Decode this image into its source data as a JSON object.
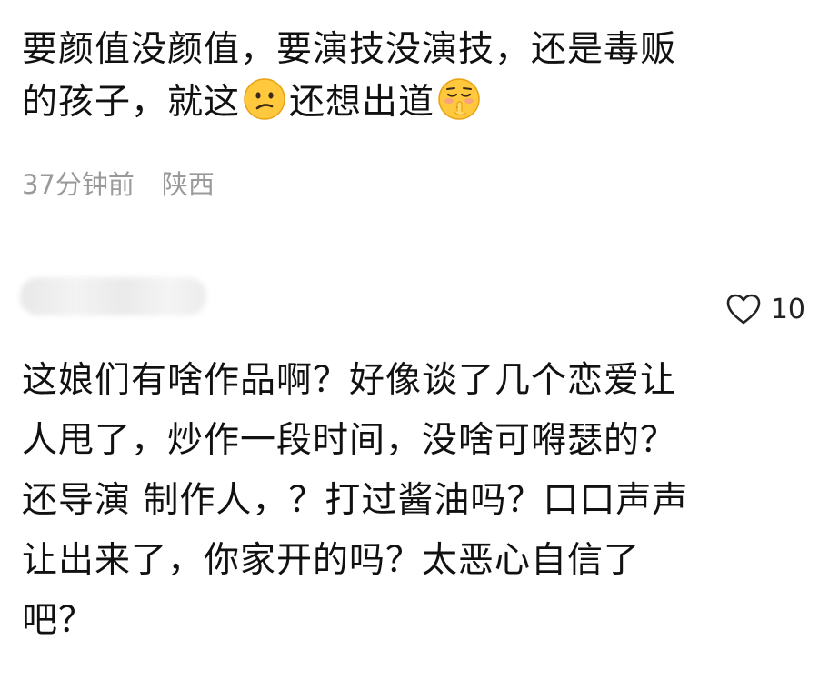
{
  "comments": [
    {
      "lines": [
        {
          "text": "要颜值没颜值，要演技没演技，还是毒贩"
        },
        {
          "text_a": "的孩子，就这",
          "emoji_1": "confused-face-emoji",
          "text_b": "还想出道",
          "emoji_2": "shushing-face-emoji"
        }
      ],
      "time": "37分钟前",
      "location": "陕西"
    },
    {
      "username_blurred": true,
      "likes": "10",
      "lines": [
        "这娘们有啥作品啊？好像谈了几个恋爱让",
        "人甩了，炒作一段时间，没啥可嘚瑟的？",
        "还导演 制作人，？打过酱油吗？口口声声",
        "让出来了，你家开的吗？太恶心自信了",
        "吧？"
      ]
    }
  ],
  "colors": {
    "text": "#111111",
    "meta": "#9a9a9a",
    "emoji_face": "#FFC83D"
  }
}
